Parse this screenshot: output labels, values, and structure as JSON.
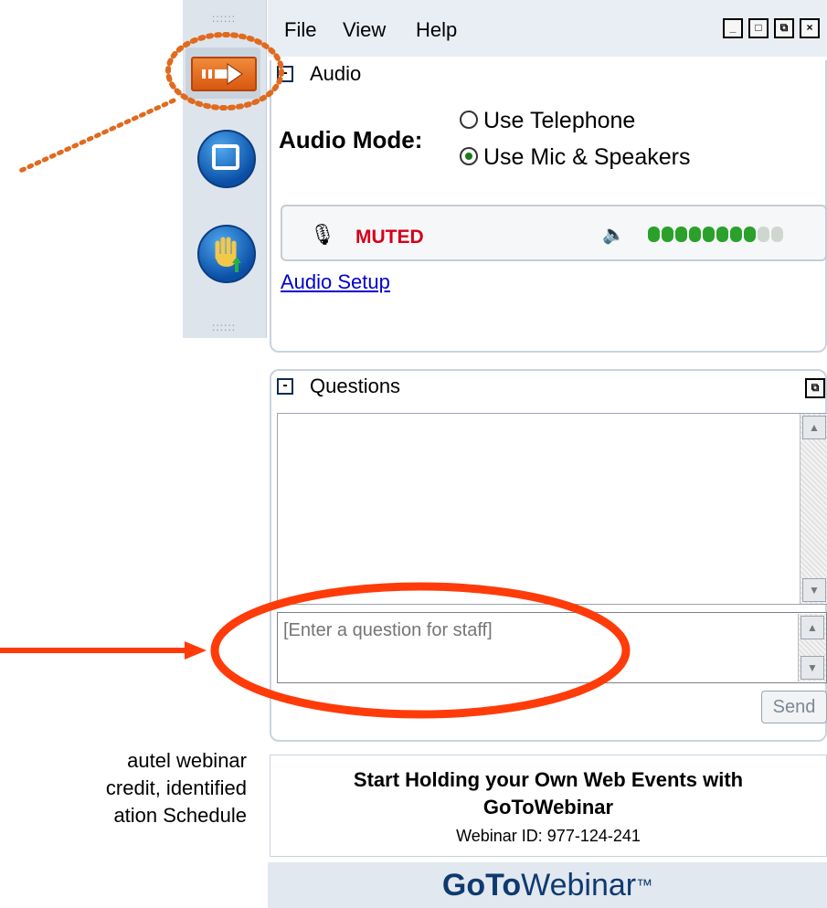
{
  "slide_text": {
    "lines": [
      "autel webinar",
      "credit, identified",
      "ation Schedule"
    ]
  },
  "menu": {
    "file": "File",
    "view": "View",
    "help": "Help"
  },
  "audio": {
    "toggle": "-",
    "title": "Audio",
    "mode_label": "Audio Mode:",
    "option_telephone": "Use Telephone",
    "option_mic": "Use Mic & Speakers",
    "selected_option": "Use Mic & Speakers",
    "mic_status": "MUTED",
    "volume_level_fraction": 0.8,
    "setup_link": "Audio Setup"
  },
  "questions": {
    "toggle": "-",
    "title": "Questions",
    "input_placeholder": "[Enter a question for staff]",
    "send_label": "Send"
  },
  "promo": {
    "headline_line1": "Start Holding your Own Web Events with",
    "headline_line2": "GoToWebinar",
    "webinar_id": "Webinar ID: 977-124-241"
  },
  "footer": {
    "brand_bold": "GoTo",
    "brand_light": "Webinar",
    "trademark": "™"
  },
  "colors": {
    "accent_orange": "#e06a1f",
    "annotation_red": "#ff3b0a",
    "muted_red": "#d4001a",
    "meter_green": "#2aa12a",
    "link_blue": "#0000cc"
  }
}
